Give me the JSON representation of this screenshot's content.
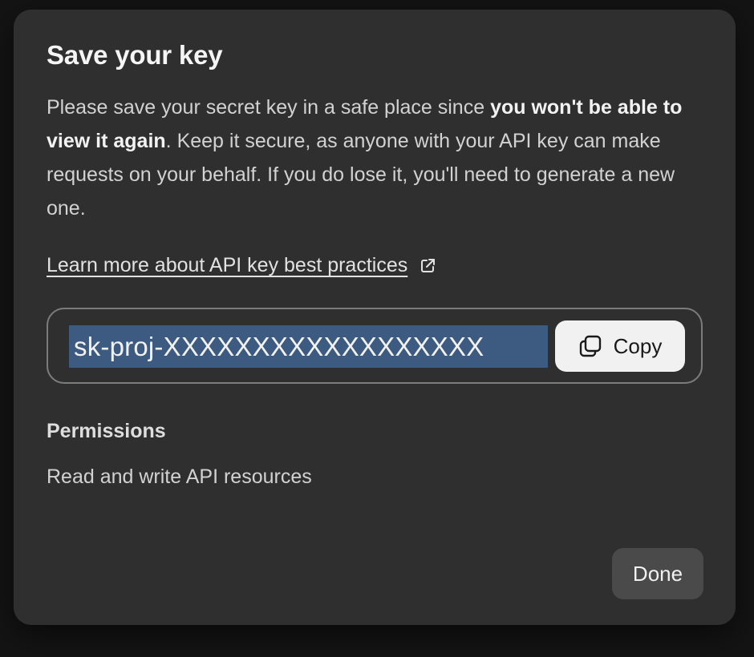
{
  "dialog": {
    "title": "Save your key",
    "description": {
      "part1": "Please save your secret key in a safe place since ",
      "bold": "you won't be able to view it again",
      "part2": ". Keep it secure, as anyone with your API key can make requests on your behalf. If you do lose it, you'll need to generate a new one."
    },
    "learn_more_label": "Learn more about API key best practices",
    "key": {
      "value": "sk-proj-XXXXXXXXXXXXXXXXXX",
      "copy_label": "Copy"
    },
    "permissions": {
      "heading": "Permissions",
      "value": "Read and write API resources"
    },
    "done_label": "Done"
  },
  "colors": {
    "modal_background": "#2f2f2f",
    "page_background": "#141414",
    "key_selection": "#3d5a80",
    "copy_button": "#f1f1f1",
    "done_button": "#4a4a4a"
  },
  "icons": {
    "external_link": "external-link-icon",
    "copy": "copy-icon"
  }
}
